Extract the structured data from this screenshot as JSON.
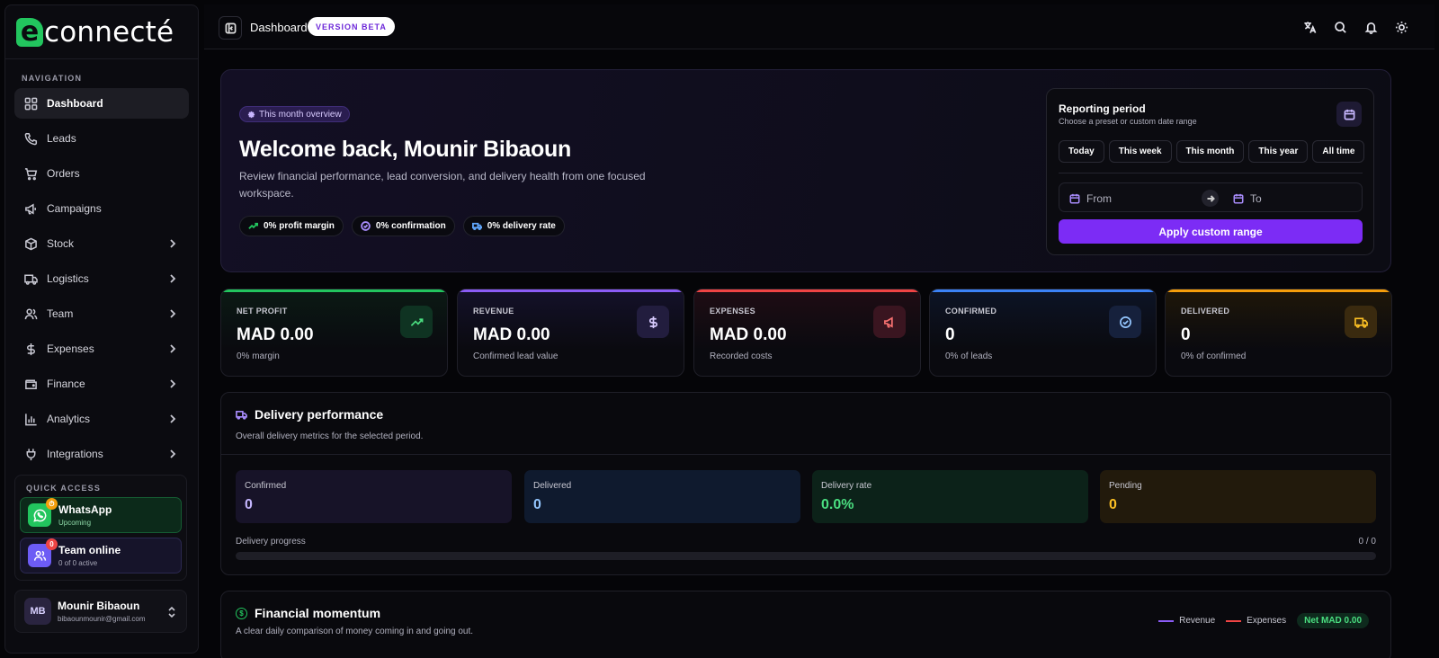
{
  "brand": {
    "mark": "e",
    "name": "connecté"
  },
  "sidebar": {
    "heading": "NAVIGATION",
    "items": [
      {
        "label": "Dashboard",
        "icon": "grid-icon",
        "active": true
      },
      {
        "label": "Leads",
        "icon": "phone-icon"
      },
      {
        "label": "Orders",
        "icon": "cart-icon"
      },
      {
        "label": "Campaigns",
        "icon": "megaphone-icon"
      },
      {
        "label": "Stock",
        "icon": "box-icon",
        "expandable": true
      },
      {
        "label": "Logistics",
        "icon": "truck-icon",
        "expandable": true
      },
      {
        "label": "Team",
        "icon": "users-icon",
        "expandable": true
      },
      {
        "label": "Expenses",
        "icon": "dollar-icon",
        "expandable": true
      },
      {
        "label": "Finance",
        "icon": "wallet-icon",
        "expandable": true
      },
      {
        "label": "Analytics",
        "icon": "bar-chart-icon",
        "expandable": true
      },
      {
        "label": "Integrations",
        "icon": "plug-icon",
        "expandable": true
      }
    ],
    "quick_access": {
      "heading": "QUICK ACCESS",
      "whatsapp": {
        "title": "WhatsApp",
        "sub": "Upcoming",
        "badge": "⏱"
      },
      "team": {
        "title": "Team online",
        "sub": "0 of 0 active",
        "badge": "0"
      }
    },
    "user": {
      "initials": "MB",
      "name": "Mounir Bibaoun",
      "email": "bibaounmounir@gmail.com"
    }
  },
  "topbar": {
    "title": "Dashboard",
    "badge": "VERSION BETA"
  },
  "hero": {
    "pill": "This month overview",
    "title": "Welcome back, Mounir Bibaoun",
    "description": "Review financial performance, lead conversion, and delivery health from one focused workspace.",
    "chips": [
      "0% profit margin",
      "0% confirmation",
      "0% delivery rate"
    ]
  },
  "reporting": {
    "title": "Reporting period",
    "subtitle": "Choose a preset or custom date range",
    "presets": [
      "Today",
      "This week",
      "This month",
      "This year",
      "All time"
    ],
    "from_placeholder": "From",
    "to_placeholder": "To",
    "apply": "Apply custom range"
  },
  "stats": [
    {
      "label": "NET PROFIT",
      "value": "MAD 0.00",
      "sub": "0% margin",
      "color": "#22c55e"
    },
    {
      "label": "REVENUE",
      "value": "MAD 0.00",
      "sub": "Confirmed lead value",
      "color": "#8b5cf6"
    },
    {
      "label": "EXPENSES",
      "value": "MAD 0.00",
      "sub": "Recorded costs",
      "color": "#ef4444"
    },
    {
      "label": "CONFIRMED",
      "value": "0",
      "sub": "0% of leads",
      "color": "#3b82f6"
    },
    {
      "label": "DELIVERED",
      "value": "0",
      "sub": "0% of confirmed",
      "color": "#f59e0b"
    }
  ],
  "delivery": {
    "title": "Delivery performance",
    "subtitle": "Overall delivery metrics for the selected period.",
    "metrics": [
      {
        "label": "Confirmed",
        "value": "0"
      },
      {
        "label": "Delivered",
        "value": "0"
      },
      {
        "label": "Delivery rate",
        "value": "0.0%"
      },
      {
        "label": "Pending",
        "value": "0"
      }
    ],
    "progress_label": "Delivery progress",
    "progress_value": "0 / 0",
    "progress_fraction": 0
  },
  "financial": {
    "title": "Financial momentum",
    "subtitle": "A clear daily comparison of money coming in and going out.",
    "legend": [
      "Revenue",
      "Expenses"
    ],
    "net": "Net MAD 0.00"
  }
}
